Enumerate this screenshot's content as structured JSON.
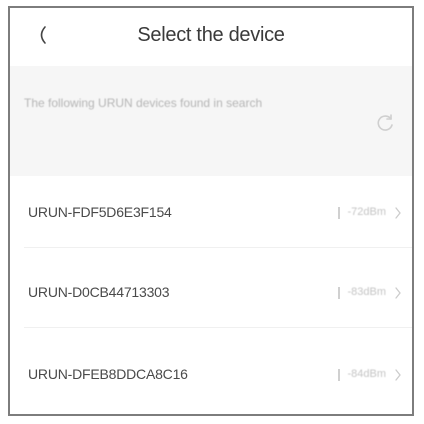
{
  "header": {
    "title": "Select the device",
    "back_icon": "back-chevron-icon"
  },
  "notice": {
    "text": "The following URUN devices found in search",
    "refresh_icon": "refresh-icon"
  },
  "devices": [
    {
      "name": "URUN-FDF5D6E3F154",
      "signal": "-72dBm",
      "signal_icon": "signal-icon",
      "chevron_icon": "chevron-right-icon"
    },
    {
      "name": "URUN-D0CB44713303",
      "signal": "-83dBm",
      "signal_icon": "signal-icon",
      "chevron_icon": "chevron-right-icon"
    },
    {
      "name": "URUN-DFEB8DDCA8C16",
      "signal": "-84dBm",
      "signal_icon": "signal-icon",
      "chevron_icon": "chevron-right-icon"
    }
  ],
  "colors": {
    "background": "#ffffff",
    "notice_background": "#f6f6f6",
    "frame_border": "#7d7d7d",
    "muted_text": "#c4c4c4"
  }
}
